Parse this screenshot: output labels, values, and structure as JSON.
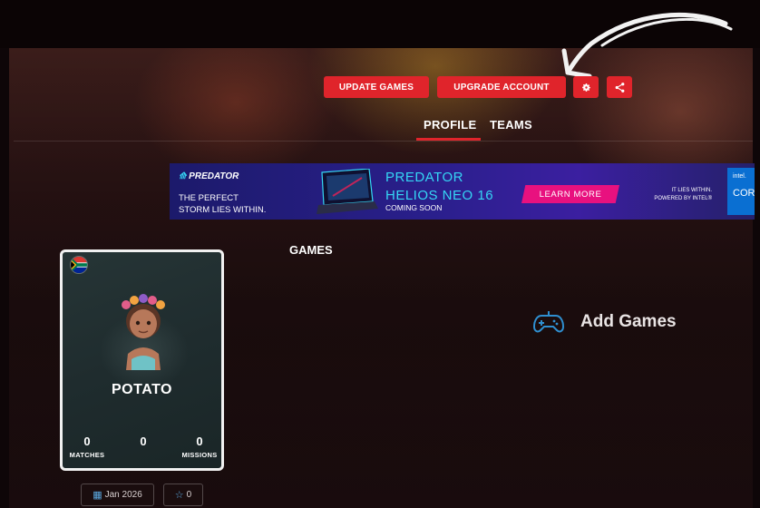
{
  "header": {
    "update_games_label": "UPDATE GAMES",
    "upgrade_account_label": "UPGRADE ACCOUNT",
    "settings_icon": "gear-icon",
    "share_icon": "share-icon"
  },
  "tabs": [
    {
      "label": "PROFILE",
      "active": true
    },
    {
      "label": "TEAMS",
      "active": false
    }
  ],
  "ad": {
    "brand": "PREDATOR",
    "tagline_line1": "THE PERFECT",
    "tagline_line2": "STORM LIES WITHIN.",
    "product_line1": "PREDATOR",
    "product_line2": "HELIOS NEO 16",
    "coming_soon": "COMING SOON",
    "cta": "LEARN MORE",
    "intel_line1": "IT LIES WITHIN.",
    "intel_line2": "POWERED BY INTEL®",
    "intel_word": "intel.",
    "intel_core": "COR"
  },
  "games": {
    "section_label": "GAMES",
    "add_label": "Add Games"
  },
  "profile": {
    "name": "POTATO",
    "stats": [
      {
        "value": "0",
        "label": "MATCHES"
      },
      {
        "value": "0",
        "label": ""
      },
      {
        "value": "0",
        "label": "MISSIONS"
      }
    ],
    "joined": "Jan 2026",
    "stars": "0"
  },
  "colors": {
    "accent": "#e0242b",
    "ad_cyan": "#35d6f5",
    "ad_pink": "#e8117f"
  }
}
